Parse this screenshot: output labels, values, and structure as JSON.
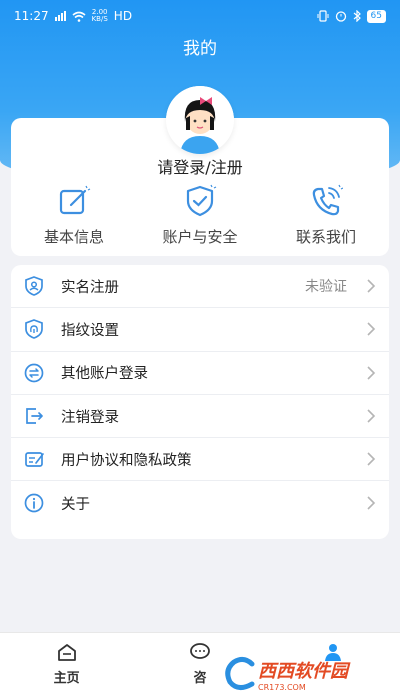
{
  "status_bar": {
    "time": "11:27",
    "network_speed_value": "2.00",
    "network_speed_unit": "KB/S",
    "network_type": "HD",
    "battery": "65"
  },
  "page": {
    "title": "我的"
  },
  "profile": {
    "login_text": "请登录/注册",
    "quick_actions": [
      {
        "label": "基本信息",
        "icon": "edit-icon"
      },
      {
        "label": "账户与安全",
        "icon": "shield-check-icon"
      },
      {
        "label": "联系我们",
        "icon": "phone-icon"
      }
    ]
  },
  "menu": {
    "items": [
      {
        "label": "实名注册",
        "value": "未验证",
        "icon": "id-shield-icon"
      },
      {
        "label": "指纹设置",
        "value": "",
        "icon": "fingerprint-shield-icon"
      },
      {
        "label": "其他账户登录",
        "value": "",
        "icon": "switch-account-icon"
      },
      {
        "label": "注销登录",
        "value": "",
        "icon": "logout-icon"
      },
      {
        "label": "用户协议和隐私政策",
        "value": "",
        "icon": "agreement-icon"
      },
      {
        "label": "关于",
        "value": "",
        "icon": "info-icon"
      }
    ]
  },
  "tabbar": {
    "tabs": [
      {
        "label": "主页",
        "icon": "home-icon"
      },
      {
        "label": "咨",
        "icon": "chat-icon"
      },
      {
        "label": "",
        "icon": "user-icon"
      }
    ]
  },
  "watermark": {
    "text": "西西软件园",
    "sub": "CR173.COM"
  },
  "colors": {
    "primary": "#2196f3",
    "icon_blue": "#3d8fe0",
    "chevron": "#b5b5b5"
  }
}
